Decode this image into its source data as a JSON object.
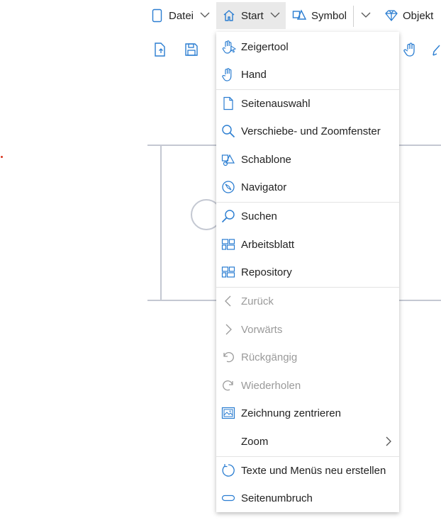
{
  "colors": {
    "accent": "#2a7dd1",
    "disabled": "#9a9a9a",
    "canvas_line": "#c4c8d2"
  },
  "topbar": {
    "datei": {
      "label": "Datei",
      "icon": "document-icon"
    },
    "start": {
      "label": "Start",
      "icon": "home-icon"
    },
    "symbol": {
      "label": "Symbol",
      "icon": "shapes-icon"
    },
    "objekt": {
      "label": "Objekt",
      "icon": "diamond-icon"
    }
  },
  "menu": {
    "items": [
      {
        "label": "Zeigertool",
        "icon": "pointer-hand-icon",
        "enabled": true
      },
      {
        "label": "Hand",
        "icon": "hand-icon",
        "enabled": true
      },
      {
        "label": "Seitenauswahl",
        "icon": "page-icon",
        "enabled": true
      },
      {
        "label": "Verschiebe- und Zoomfenster",
        "icon": "magnifier-icon",
        "enabled": true
      },
      {
        "label": "Schablone",
        "icon": "stencil-icon",
        "enabled": true
      },
      {
        "label": "Navigator",
        "icon": "compass-icon",
        "enabled": true
      },
      {
        "label": "Suchen",
        "icon": "search-icon",
        "enabled": true
      },
      {
        "label": "Arbeitsblatt",
        "icon": "worksheet-icon",
        "enabled": true
      },
      {
        "label": "Repository",
        "icon": "repository-icon",
        "enabled": true
      },
      {
        "label": "Zurück",
        "icon": "chevron-left-icon",
        "enabled": false
      },
      {
        "label": "Vorwärts",
        "icon": "chevron-right-icon",
        "enabled": false
      },
      {
        "label": "Rückgängig",
        "icon": "undo-icon",
        "enabled": false
      },
      {
        "label": "Wiederholen",
        "icon": "redo-icon",
        "enabled": false
      },
      {
        "label": "Zeichnung zentrieren",
        "icon": "center-drawing-icon",
        "enabled": true
      },
      {
        "label": "Zoom",
        "icon": "",
        "enabled": true
      },
      {
        "label": "Texte und Menüs neu erstellen",
        "icon": "refresh-icon",
        "enabled": true
      },
      {
        "label": "Seitenumbruch",
        "icon": "page-break-icon",
        "enabled": true
      }
    ]
  }
}
